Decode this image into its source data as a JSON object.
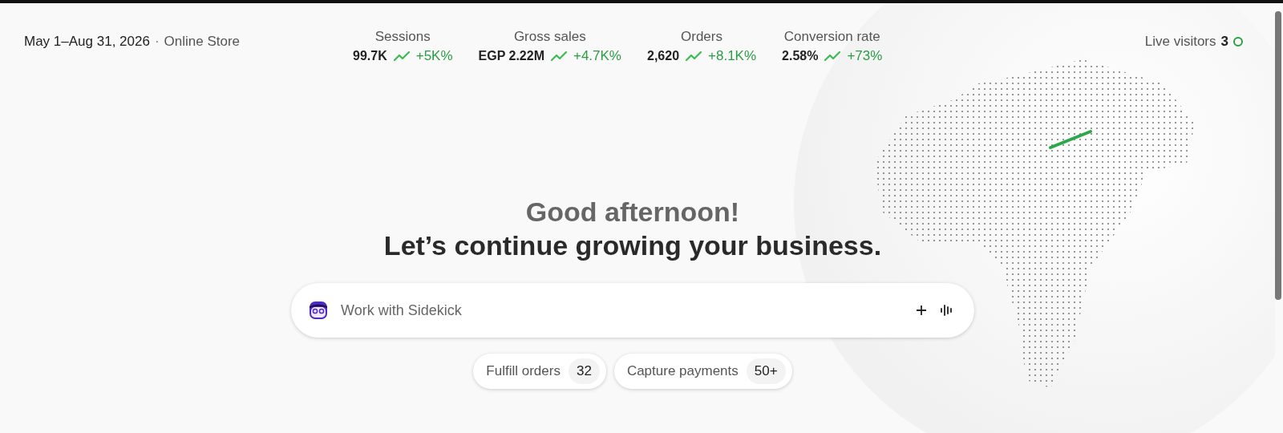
{
  "header": {
    "date_range": "May 1–Aug 31, 2026",
    "separator": "·",
    "channel": "Online Store"
  },
  "metrics": [
    {
      "label": "Sessions",
      "value": "99.7K",
      "change": "+5K%"
    },
    {
      "label": "Gross sales",
      "value": "EGP 2.22M",
      "change": "+4.7K%"
    },
    {
      "label": "Orders",
      "value": "2,620",
      "change": "+8.1K%"
    },
    {
      "label": "Conversion rate",
      "value": "2.58%",
      "change": "+73%"
    }
  ],
  "live_visitors": {
    "label": "Live visitors",
    "count": "3"
  },
  "greeting": {
    "title": "Good afternoon!",
    "subtitle": "Let’s continue growing your business."
  },
  "prompt": {
    "placeholder": "Work with Sidekick"
  },
  "tasks": [
    {
      "label": "Fulfill orders",
      "count": "32"
    },
    {
      "label": "Capture payments",
      "count": "50+"
    }
  ]
}
